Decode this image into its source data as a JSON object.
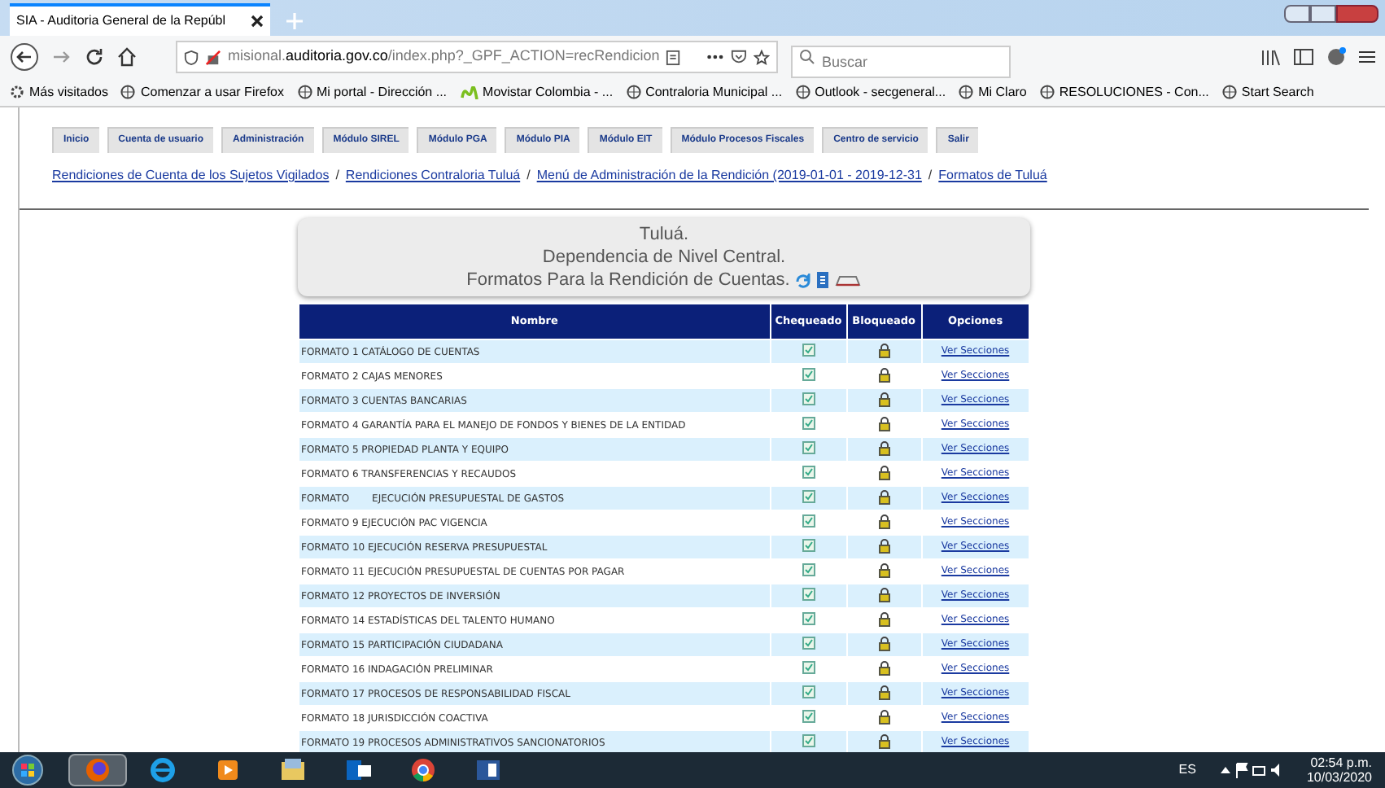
{
  "browser": {
    "tab_title": "SIA - Auditoria General de la Repúbl",
    "url_host": "misional.",
    "url_domain": "auditoria.gov.co",
    "url_path": "/index.php?_GPF_ACTION=recRendicion",
    "search": {
      "placeholder": "Buscar"
    },
    "bookmarks": [
      {
        "label": "Más visitados",
        "kind": "gear"
      },
      {
        "label": "Comenzar a usar Firefox",
        "kind": "globe"
      },
      {
        "label": "Mi portal - Dirección ...",
        "kind": "globe"
      },
      {
        "label": "Movistar Colombia - ...",
        "kind": "m"
      },
      {
        "label": "Contraloria Municipal ...",
        "kind": "globe"
      },
      {
        "label": "Outlook - secgeneral...",
        "kind": "globe"
      },
      {
        "label": "Mi Claro",
        "kind": "globe"
      },
      {
        "label": "RESOLUCIONES - Con...",
        "kind": "globe"
      },
      {
        "label": "Start Search",
        "kind": "globe"
      }
    ]
  },
  "menu": [
    {
      "label": "Inicio"
    },
    {
      "label": "Cuenta de usuario"
    },
    {
      "label": "Administración"
    },
    {
      "label": "Módulo SIREL"
    },
    {
      "label": "Módulo PGA"
    },
    {
      "label": "Módulo PIA"
    },
    {
      "label": "Módulo EIT"
    },
    {
      "label": "Módulo Procesos Fiscales"
    },
    {
      "label": "Centro de servicio"
    },
    {
      "label": "Salir"
    }
  ],
  "breadcrumb_separator": "/",
  "breadcrumb": [
    "Rendiciones de Cuenta de los Sujetos Vigilados",
    "Rendiciones Contraloria Tuluá",
    "Menú de Administración de la Rendición (2019-01-01 - 2019-12-31",
    "Formatos de Tuluá"
  ],
  "header": {
    "lines": [
      "Tuluá.",
      "Dependencia de Nivel Central.",
      "Formatos Para la Rendición de Cuentas."
    ]
  },
  "table": {
    "columns": [
      "Nombre",
      "Chequeado",
      "Bloqueado",
      "Opciones"
    ],
    "rows": [
      {
        "name": "FORMATO 1 CATÁLOGO DE CUENTAS",
        "checked": true,
        "locked": true,
        "link": "Ver Secciones"
      },
      {
        "name": "FORMATO 2 CAJAS MENORES",
        "checked": true,
        "locked": true,
        "link": "Ver Secciones"
      },
      {
        "name": "FORMATO 3 CUENTAS BANCARIAS",
        "checked": true,
        "locked": true,
        "link": "Ver Secciones"
      },
      {
        "name": "FORMATO 4 GARANTÍA PARA EL MANEJO DE FONDOS Y BIENES DE LA ENTIDAD",
        "checked": true,
        "locked": true,
        "link": "Ver Secciones"
      },
      {
        "name": "FORMATO 5 PROPIEDAD PLANTA Y EQUIPO",
        "checked": true,
        "locked": true,
        "link": "Ver Secciones"
      },
      {
        "name": "FORMATO 6 TRANSFERENCIAS Y RECAUDOS",
        "checked": true,
        "locked": true,
        "link": "Ver Secciones"
      },
      {
        "name": "FORMATO",
        "name_tail": "EJECUCIÓN PRESUPUESTAL DE GASTOS",
        "checked": true,
        "locked": true,
        "link": "Ver Secciones"
      },
      {
        "name": "FORMATO 9 EJECUCIÓN PAC VIGENCIA",
        "checked": true,
        "locked": true,
        "link": "Ver Secciones"
      },
      {
        "name": "FORMATO 10 EJECUCIÓN RESERVA PRESUPUESTAL",
        "checked": true,
        "locked": true,
        "link": "Ver Secciones"
      },
      {
        "name": "FORMATO 11 EJECUCIÓN PRESUPUESTAL DE CUENTAS POR PAGAR",
        "checked": true,
        "locked": true,
        "link": "Ver Secciones"
      },
      {
        "name": "FORMATO 12 PROYECTOS DE INVERSIÓN",
        "checked": true,
        "locked": true,
        "link": "Ver Secciones"
      },
      {
        "name": "FORMATO 14 ESTADÍSTICAS DEL TALENTO HUMANO",
        "checked": true,
        "locked": true,
        "link": "Ver Secciones"
      },
      {
        "name": "FORMATO 15 PARTICIPACIÓN CIUDADANA",
        "checked": true,
        "locked": true,
        "link": "Ver Secciones"
      },
      {
        "name": "FORMATO 16 INDAGACIÓN PRELIMINAR",
        "checked": true,
        "locked": true,
        "link": "Ver Secciones"
      },
      {
        "name": "FORMATO 17 PROCESOS DE RESPONSABILIDAD FISCAL",
        "checked": true,
        "locked": true,
        "link": "Ver Secciones"
      },
      {
        "name": "FORMATO 18 JURISDICCIÓN COACTIVA",
        "checked": true,
        "locked": true,
        "link": "Ver Secciones"
      },
      {
        "name": "FORMATO 19 PROCESOS ADMINISTRATIVOS SANCIONATORIOS",
        "checked": true,
        "locked": true,
        "link": "Ver Secciones"
      }
    ]
  },
  "taskbar": {
    "apps": [
      {
        "kind": "firefox",
        "selected": true
      },
      {
        "kind": "ie",
        "selected": false
      },
      {
        "kind": "media",
        "selected": false
      },
      {
        "kind": "folder",
        "selected": false
      },
      {
        "kind": "outlook",
        "selected": false
      },
      {
        "kind": "chrome",
        "selected": false
      },
      {
        "kind": "word",
        "selected": false
      }
    ],
    "language": "ES",
    "time": "02:54 p.m.",
    "date": "10/03/2020"
  }
}
